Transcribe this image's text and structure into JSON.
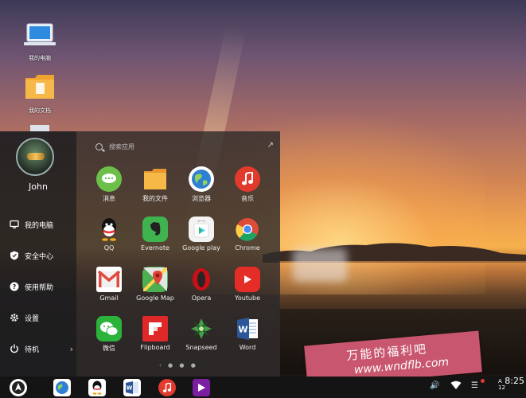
{
  "desktop": {
    "icons": [
      {
        "label": "我的电脑"
      },
      {
        "label": "我的文档"
      }
    ]
  },
  "start_menu": {
    "user": {
      "name": "John"
    },
    "items": [
      {
        "label": "我的电脑",
        "icon": "monitor-icon"
      },
      {
        "label": "安全中心",
        "icon": "shield-icon"
      },
      {
        "label": "使用帮助",
        "icon": "help-icon"
      },
      {
        "label": "设置",
        "icon": "gear-icon"
      },
      {
        "label": "待机",
        "icon": "power-icon",
        "chevron": "›"
      }
    ],
    "search": {
      "placeholder": "搜索应用"
    },
    "expand_glyph": "↗",
    "apps": [
      {
        "label": "消息",
        "icon": "messages-icon",
        "color": "#6cc04a"
      },
      {
        "label": "我的文件",
        "icon": "folder-icon",
        "color": "#f2a93b"
      },
      {
        "label": "浏览器",
        "icon": "browser-icon",
        "color": "#2f7fd3"
      },
      {
        "label": "音乐",
        "icon": "music-icon",
        "color": "#e23b2e"
      },
      {
        "label": "QQ",
        "icon": "qq-icon",
        "color": "#111111"
      },
      {
        "label": "Evernote",
        "icon": "evernote-icon",
        "color": "#3fb34f"
      },
      {
        "label": "Google play",
        "icon": "google-play-icon",
        "color": "#ffffff"
      },
      {
        "label": "Chrome",
        "icon": "chrome-icon",
        "color": "#dd4b39"
      },
      {
        "label": "Gmail",
        "icon": "gmail-icon",
        "color": "#e04a3f"
      },
      {
        "label": "Google Map",
        "icon": "google-map-icon",
        "color": "#4caf50"
      },
      {
        "label": "Opera",
        "icon": "opera-icon",
        "color": "#cc0f16"
      },
      {
        "label": "Youtube",
        "icon": "youtube-icon",
        "color": "#e52d27"
      },
      {
        "label": "微信",
        "icon": "wechat-icon",
        "color": "#2cb33b"
      },
      {
        "label": "Flipboard",
        "icon": "flipboard-icon",
        "color": "#e12828"
      },
      {
        "label": "Snapseed",
        "icon": "snapseed-icon",
        "color": "#2e7d32"
      },
      {
        "label": "Word",
        "icon": "word-icon",
        "color": "#2b579a"
      }
    ],
    "page_dots": "‹ ● ● ●"
  },
  "taskbar": {
    "start_button": "start-logo-icon",
    "pinned": [
      {
        "name": "browser-icon"
      },
      {
        "name": "qq-icon"
      },
      {
        "name": "word-icon"
      },
      {
        "name": "music-icon"
      },
      {
        "name": "video-icon"
      }
    ],
    "tray": {
      "volume": "🔊",
      "wifi": "wifi-icon",
      "notifications": "☰",
      "input": "A\n12",
      "clock": "8:25"
    }
  },
  "watermark": {
    "title": "万能的福利吧",
    "url": "www.wndflb.com"
  }
}
